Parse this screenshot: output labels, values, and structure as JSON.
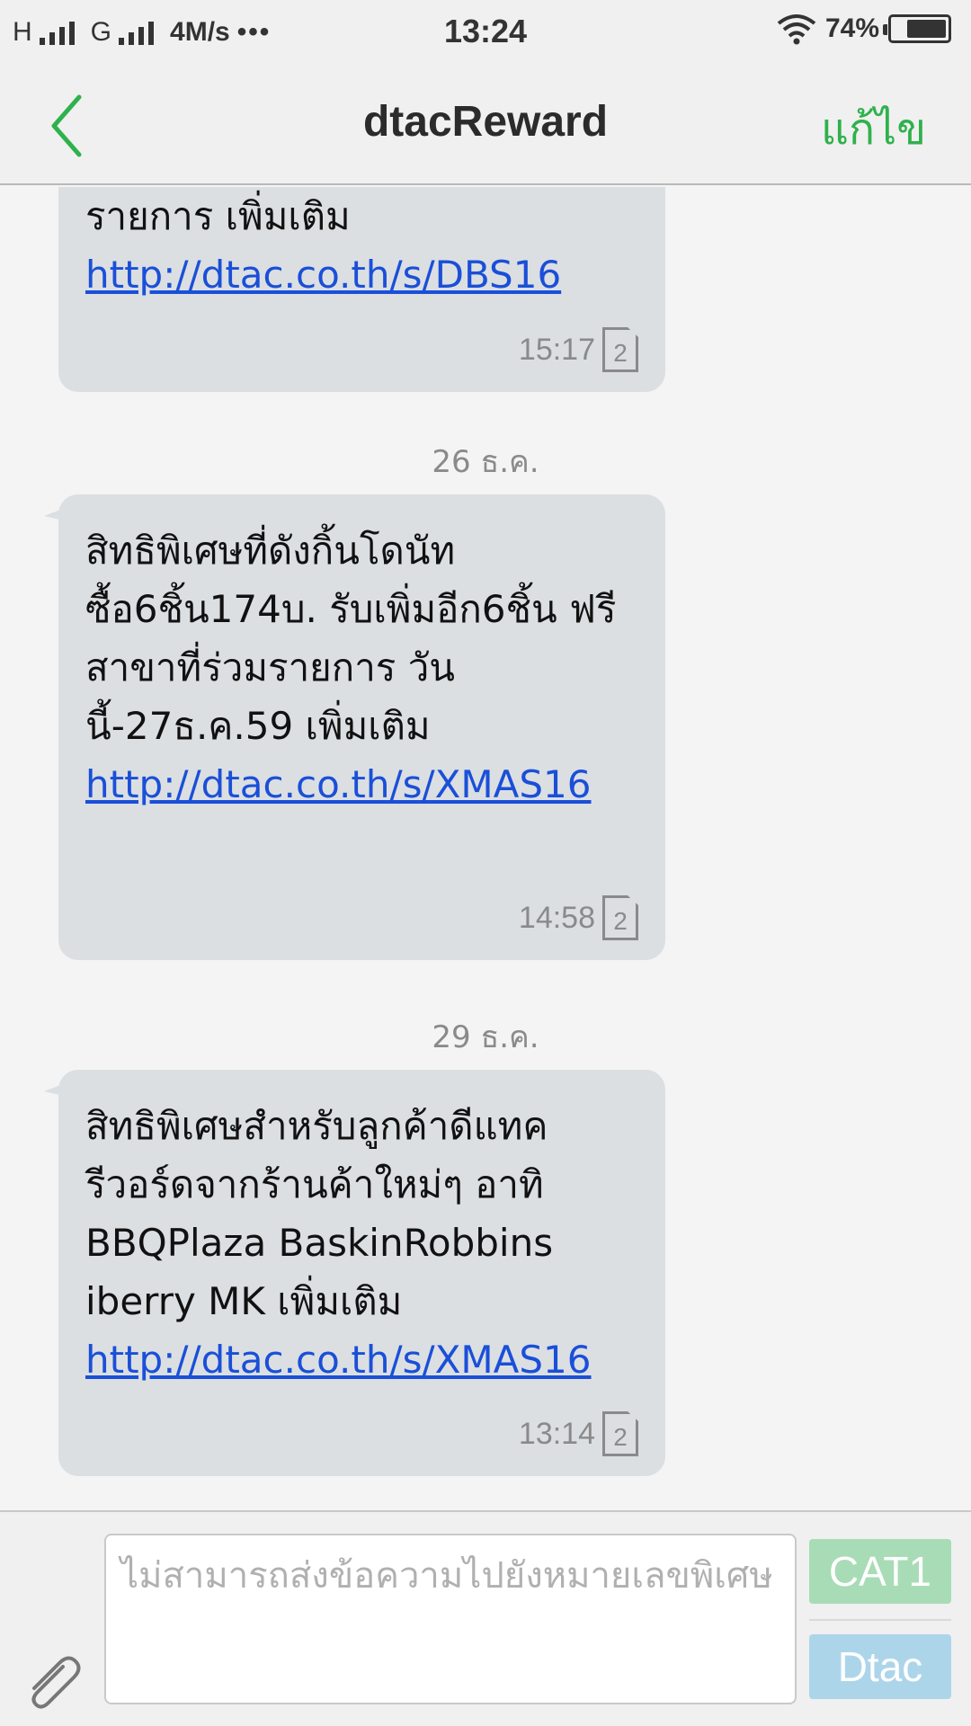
{
  "status_bar": {
    "network1": "H",
    "network2": "G",
    "speed": "4M/s",
    "more": "•••",
    "time": "13:24",
    "battery_text": "74%",
    "battery_level": 0.74,
    "wifi_icon": "wifi-icon",
    "signal_icon": "signal-bars-icon"
  },
  "header": {
    "back_icon": "chevron-left-icon",
    "title": "dtacReward",
    "edit_label": "แก้ไข"
  },
  "messages": [
    {
      "text": "รายการ  เพิ่มเติม ",
      "link": "http://dtac.co.th/s/DBS16",
      "time": "15:17",
      "sim": "2"
    },
    {
      "date": "26 ธ.ค.",
      "text": "สิทธิพิเศษที่ดังกิ้นโดนัท ซื้อ6ชิ้น174บ. รับเพิ่มอีก6ชิ้น ฟรี สาขาที่ร่วมรายการ วันนี้-27ธ.ค.59 เพิ่มเติม ",
      "link": "http://dtac.co.th/s/XMAS16",
      "time": "14:58",
      "sim": "2"
    },
    {
      "date": "29 ธ.ค.",
      "text": "สิทธิพิเศษสำหรับลูกค้าดีแทครีวอร์ดจากร้านค้าใหม่ๆ อาทิ BBQPlaza BaskinRobbins iberry MK เพิ่มเติม ",
      "link": "http://dtac.co.th/s/XMAS16",
      "time": "13:14",
      "sim": "2"
    }
  ],
  "composer": {
    "attach_icon": "paperclip-icon",
    "placeholder": "ไม่สามารถส่งข้อความไปยังหมายเลขพิเศษ",
    "sim1_label": "CAT1",
    "sim2_label": "Dtac",
    "sim1_color": "#a8dcb6",
    "sim2_color": "#add5ea"
  },
  "colors": {
    "accent_green": "#2fb14c",
    "link_blue": "#1a4fd8",
    "bubble_bg": "#dbdfe2"
  }
}
